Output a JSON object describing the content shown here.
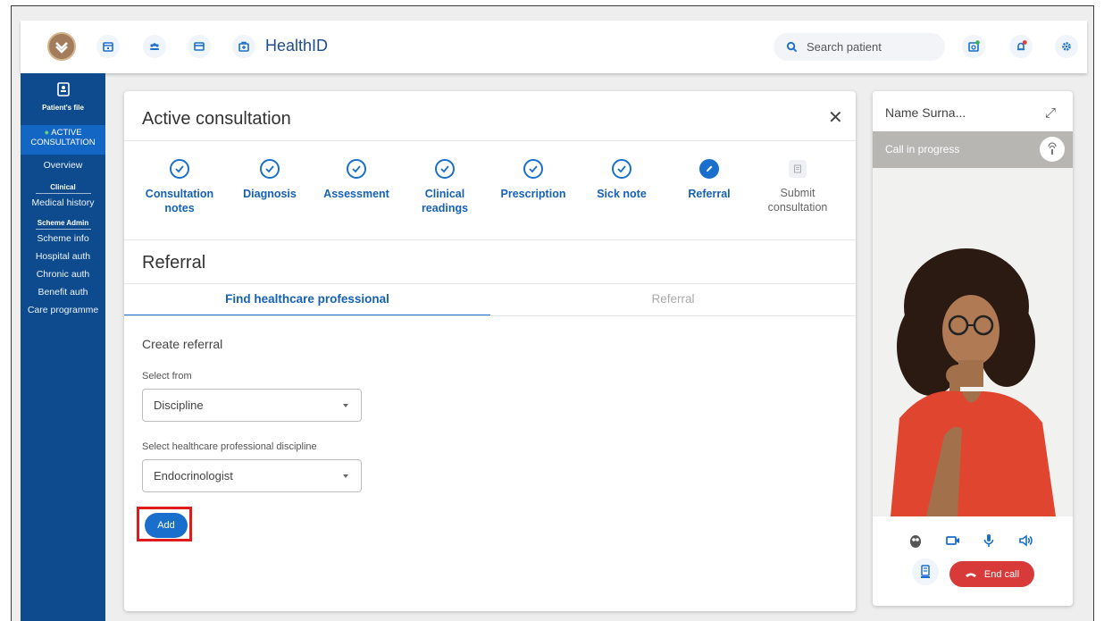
{
  "app": {
    "title": "HealthID",
    "search_placeholder": "Search patient"
  },
  "sidebar": {
    "patients_file": "Patient's file",
    "active": [
      "ACTIVE",
      "CONSULTATION"
    ],
    "overview": "Overview",
    "clinical_head": "Clinical",
    "medical_history": "Medical history",
    "scheme_head": "Scheme Admin",
    "items": [
      "Scheme info",
      "Hospital auth",
      "Chronic auth",
      "Benefit auth",
      "Care programme"
    ]
  },
  "consultation": {
    "title": "Active consultation",
    "close": "✕",
    "steps": [
      {
        "label": [
          "Consultation",
          "notes"
        ],
        "state": "done"
      },
      {
        "label": [
          "Diagnosis"
        ],
        "state": "done"
      },
      {
        "label": [
          "Assessment"
        ],
        "state": "done"
      },
      {
        "label": [
          "Clinical",
          "readings"
        ],
        "state": "done"
      },
      {
        "label": [
          "Prescription"
        ],
        "state": "done"
      },
      {
        "label": [
          "Sick note"
        ],
        "state": "done"
      },
      {
        "label": [
          "Referral"
        ],
        "state": "current"
      },
      {
        "label": [
          "Submit",
          "consultation"
        ],
        "state": "pending"
      }
    ],
    "section_title": "Referral",
    "tabs": {
      "find": "Find healthcare professional",
      "referral": "Referral"
    },
    "form": {
      "subtitle": "Create referral",
      "select_from_label": "Select from",
      "select_from_value": "Discipline",
      "discipline_label": "Select healthcare professional discipline",
      "discipline_value": "Endocrinologist",
      "add_button": "Add"
    }
  },
  "video": {
    "name": "Name Surna...",
    "status": "Call in progress",
    "end_call": "End call"
  },
  "colors": {
    "primary": "#1a6fcc",
    "sidebar": "#0d4b8e",
    "end_call": "#d83a3a",
    "highlight": "#e01b1b"
  }
}
